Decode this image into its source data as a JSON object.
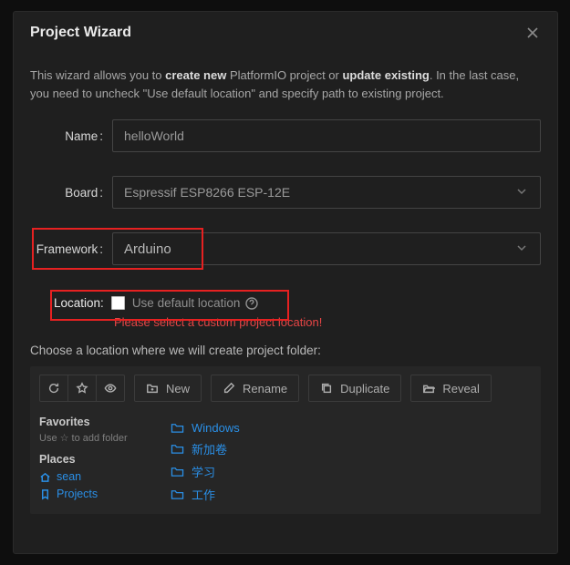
{
  "title": "Project Wizard",
  "intro": {
    "pre": "This wizard allows you to ",
    "b1": "create new",
    "mid": " PlatformIO project or ",
    "b2": "update existing",
    "post": ". In the last case, you need to uncheck \"Use default location\" and specify path to existing project."
  },
  "fields": {
    "name_label": "Name",
    "name_value": "helloWorld",
    "board_label": "Board",
    "board_value": "Espressif ESP8266 ESP-12E",
    "framework_label": "Framework",
    "framework_value": "Arduino",
    "location_label": "Location",
    "use_default_label": "Use default location",
    "error": "Please select a custom project location!"
  },
  "choose_text": "Choose a location where we will create project folder:",
  "toolbar": {
    "new": "New",
    "rename": "Rename",
    "duplicate": "Duplicate",
    "reveal": "Reveal"
  },
  "sidebar": {
    "favorites": "Favorites",
    "fav_hint": "Use ☆ to add folder",
    "places": "Places",
    "items": [
      {
        "icon": "home",
        "label": "sean"
      },
      {
        "icon": "bookmark",
        "label": "Projects"
      }
    ]
  },
  "folders": [
    "Windows",
    "新加卷",
    "学习",
    "工作"
  ]
}
